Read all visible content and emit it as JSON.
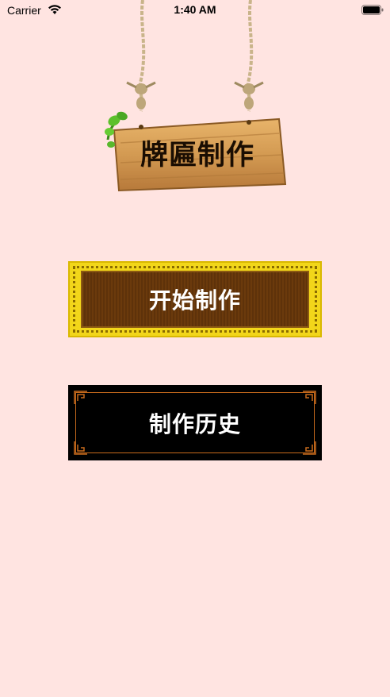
{
  "status_bar": {
    "carrier": "Carrier",
    "time": "1:40 AM",
    "icons": [
      "wifi-icon",
      "battery-icon"
    ]
  },
  "sign": {
    "title": "牌匾制作"
  },
  "buttons": {
    "start_label": "开始制作",
    "history_label": "制作历史"
  },
  "colors": {
    "background": "#ffe4e1",
    "start_gold": "#f2d61a",
    "start_panel": "#6b3a0c",
    "history_bg": "#000000",
    "history_frame": "#c76a1c",
    "wood": "#d9a05a"
  }
}
